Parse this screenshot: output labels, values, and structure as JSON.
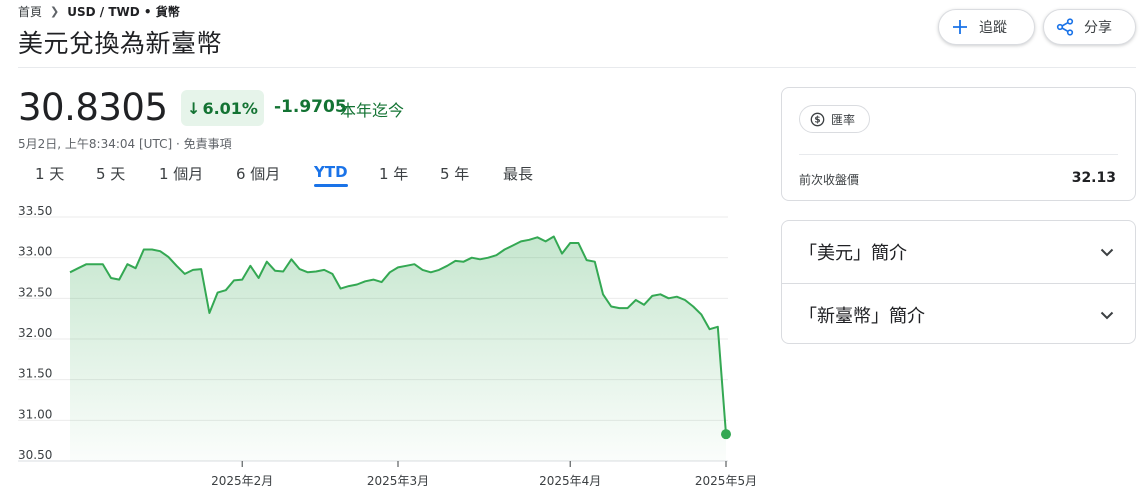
{
  "breadcrumb": {
    "home": "首頁",
    "current": "USD / TWD • 貨幣"
  },
  "title": "美元兌換為新臺幣",
  "actions": {
    "follow": "追蹤",
    "share": "分享"
  },
  "quote": {
    "price": "30.8305",
    "change_pct": "6.01%",
    "change_abs": "-1.9705",
    "period_label": "本年迄今",
    "timestamp": "5月2日, 上午8:34:04 [UTC]",
    "disclaimer": "免責事項"
  },
  "range_tabs": [
    "1 天",
    "5 天",
    "1 個月",
    "6 個月",
    "YTD",
    "1 年",
    "5 年",
    "最長"
  ],
  "active_range": "YTD",
  "colors": {
    "positive_green": "#137333",
    "line_green": "#34a853",
    "accent_blue": "#1a73e8"
  },
  "chart_data": {
    "type": "area",
    "y_ticks": [
      "33.50",
      "33.00",
      "32.50",
      "32.00",
      "31.50",
      "31.00",
      "30.50"
    ],
    "x_ticks": [
      "2025年2月",
      "2025年3月",
      "2025年4月",
      "2025年5月"
    ],
    "ylim": [
      30.5,
      33.5
    ],
    "x_axis_unit": "trading days from Jan 2, 2025",
    "x_tick_positions": [
      21,
      40,
      61,
      80
    ],
    "points": [
      [
        0,
        32.82
      ],
      [
        1,
        32.87
      ],
      [
        2,
        32.92
      ],
      [
        3,
        32.92
      ],
      [
        4,
        32.92
      ],
      [
        5,
        32.75
      ],
      [
        6,
        32.73
      ],
      [
        7,
        32.92
      ],
      [
        8,
        32.87
      ],
      [
        9,
        33.1
      ],
      [
        10,
        33.1
      ],
      [
        11,
        33.08
      ],
      [
        12,
        33.01
      ],
      [
        13,
        32.9
      ],
      [
        14,
        32.8
      ],
      [
        15,
        32.85
      ],
      [
        16,
        32.86
      ],
      [
        17,
        32.32
      ],
      [
        18,
        32.57
      ],
      [
        19,
        32.6
      ],
      [
        20,
        32.72
      ],
      [
        21,
        32.73
      ],
      [
        22,
        32.9
      ],
      [
        23,
        32.75
      ],
      [
        24,
        32.95
      ],
      [
        25,
        32.84
      ],
      [
        26,
        32.83
      ],
      [
        27,
        32.98
      ],
      [
        28,
        32.86
      ],
      [
        29,
        32.82
      ],
      [
        30,
        32.83
      ],
      [
        31,
        32.85
      ],
      [
        32,
        32.8
      ],
      [
        33,
        32.62
      ],
      [
        34,
        32.65
      ],
      [
        35,
        32.67
      ],
      [
        36,
        32.71
      ],
      [
        37,
        32.73
      ],
      [
        38,
        32.7
      ],
      [
        39,
        32.82
      ],
      [
        40,
        32.88
      ],
      [
        41,
        32.9
      ],
      [
        42,
        32.92
      ],
      [
        43,
        32.85
      ],
      [
        44,
        32.82
      ],
      [
        45,
        32.85
      ],
      [
        46,
        32.9
      ],
      [
        47,
        32.96
      ],
      [
        48,
        32.95
      ],
      [
        49,
        33.0
      ],
      [
        50,
        32.98
      ],
      [
        51,
        33.0
      ],
      [
        52,
        33.03
      ],
      [
        53,
        33.1
      ],
      [
        54,
        33.15
      ],
      [
        55,
        33.2
      ],
      [
        56,
        33.22
      ],
      [
        57,
        33.25
      ],
      [
        58,
        33.2
      ],
      [
        59,
        33.26
      ],
      [
        60,
        33.05
      ],
      [
        61,
        33.18
      ],
      [
        62,
        33.18
      ],
      [
        63,
        32.97
      ],
      [
        64,
        32.95
      ],
      [
        65,
        32.55
      ],
      [
        66,
        32.4
      ],
      [
        67,
        32.38
      ],
      [
        68,
        32.38
      ],
      [
        69,
        32.48
      ],
      [
        70,
        32.42
      ],
      [
        71,
        32.53
      ],
      [
        72,
        32.55
      ],
      [
        73,
        32.5
      ],
      [
        74,
        32.52
      ],
      [
        75,
        32.48
      ],
      [
        76,
        32.4
      ],
      [
        77,
        32.3
      ],
      [
        78,
        32.12
      ],
      [
        79,
        32.15
      ],
      [
        80,
        30.83
      ]
    ]
  },
  "stats": {
    "chip_label": "匯率",
    "prev_close_label": "前次收盤價",
    "prev_close_value": "32.13"
  },
  "about": {
    "usd": "「美元」簡介",
    "twd": "「新臺幣」簡介"
  }
}
